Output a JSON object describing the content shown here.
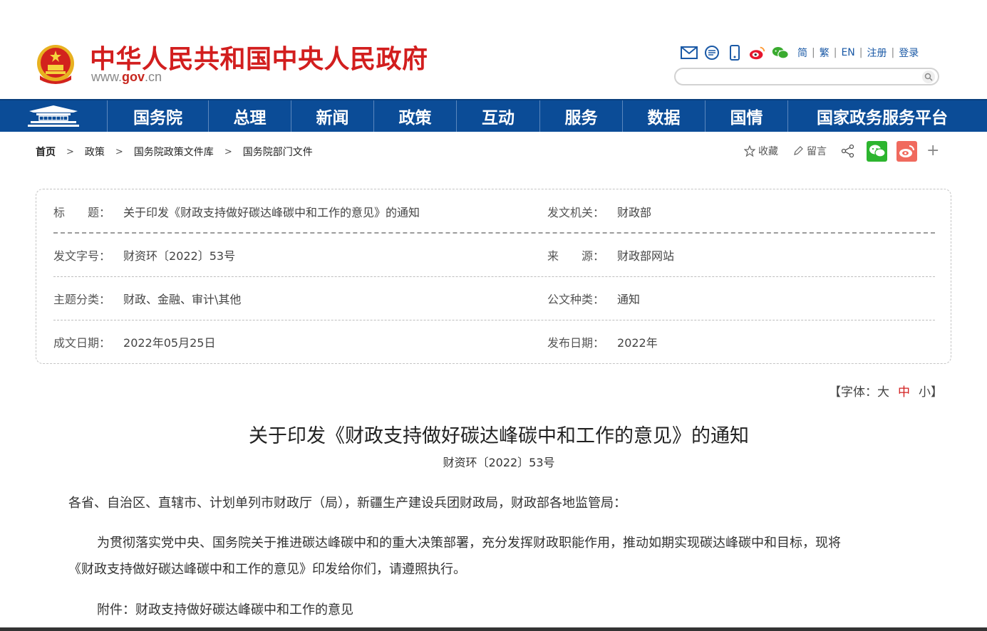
{
  "header": {
    "title": "中华人民共和国中央人民政府",
    "url_prefix": "www.",
    "url_brand": "gov",
    "url_suffix": ".cn",
    "lang_simplified": "简",
    "lang_traditional": "繁",
    "lang_english": "EN",
    "register": "注册",
    "login": "登录",
    "separator": "|",
    "search_placeholder": ""
  },
  "nav": {
    "items": [
      "国务院",
      "总理",
      "新闻",
      "政策",
      "互动",
      "服务",
      "数据",
      "国情",
      "国家政务服务平台"
    ]
  },
  "breadcrumb": {
    "items": [
      "首页",
      "政策",
      "国务院政策文件库",
      "国务院部门文件"
    ],
    "arrow": ">"
  },
  "share": {
    "favorite": "收藏",
    "comment": "留言",
    "more": "+"
  },
  "info": {
    "rows": [
      {
        "l_label": "标　　题：",
        "l_value": "关于印发《财政支持做好碳达峰碳中和工作的意见》的通知",
        "r_label": "发文机关：",
        "r_value": "财政部"
      },
      {
        "l_label": "发文字号：",
        "l_value": "财资环〔2022〕53号",
        "r_label": "来　　源：",
        "r_value": "财政部网站"
      },
      {
        "l_label": "主题分类：",
        "l_value": "财政、金融、审计\\其他",
        "r_label": "公文种类：",
        "r_value": "通知"
      },
      {
        "l_label": "成文日期：",
        "l_value": "2022年05月25日",
        "r_label": "发布日期：",
        "r_value": "2022年"
      }
    ]
  },
  "font_size": {
    "open": "【字体：",
    "large": "大",
    "medium": "中",
    "small": "小",
    "close": "】"
  },
  "article": {
    "title": "关于印发《财政支持做好碳达峰碳中和工作的意见》的通知",
    "doc_no": "财资环〔2022〕53号",
    "salutation": "各省、自治区、直辖市、计划单列市财政厅（局），新疆生产建设兵团财政局，财政部各地监管局：",
    "body_line1": "为贯彻落实党中央、国务院关于推进碳达峰碳中和的重大决策部署，充分发挥财政职能作用，推动如期实现碳达峰碳中和目标，现将",
    "body_line2": "《财政支持做好碳达峰碳中和工作的意见》印发给你们，请遵照执行。",
    "attachment": "附件：财政支持做好碳达峰碳中和工作的意见"
  },
  "colors": {
    "brand_red": "#d21e1e",
    "nav_blue": "#0b4c97",
    "link_blue": "#1a59a6"
  }
}
